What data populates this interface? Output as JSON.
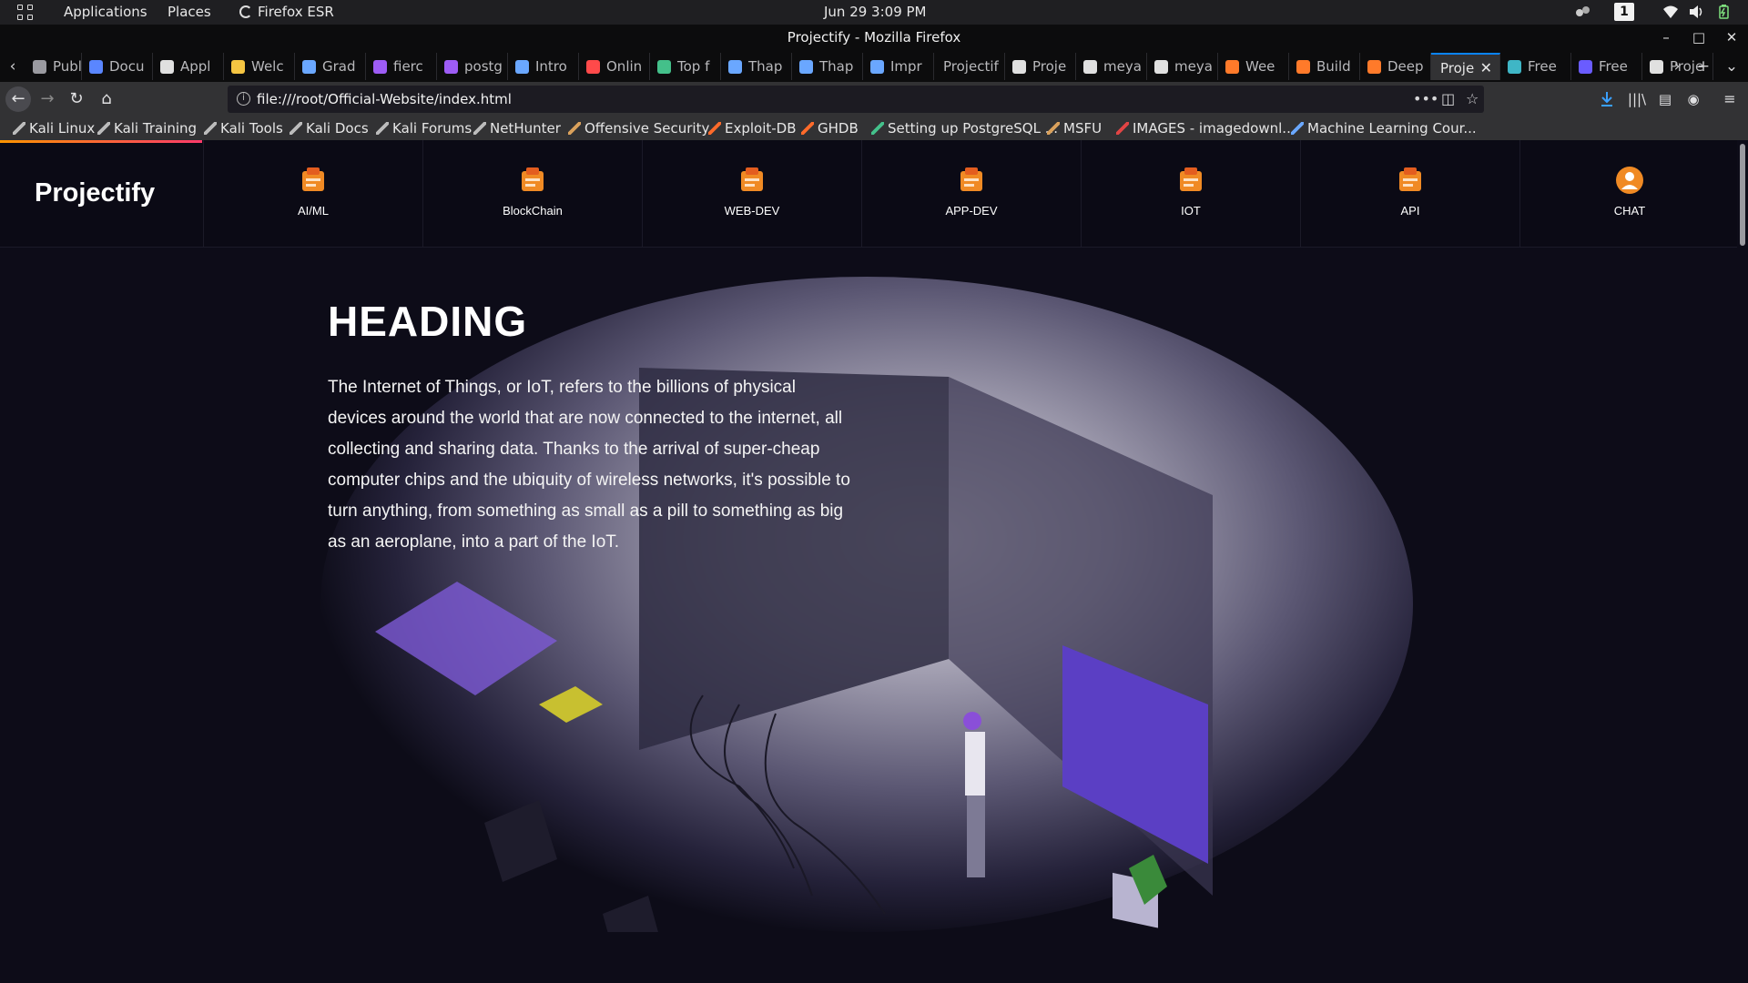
{
  "os_bar": {
    "applications": "Applications",
    "places": "Places",
    "browser": "Firefox ESR",
    "datetime": "Jun 29  3:09 PM",
    "workspace": "1"
  },
  "window": {
    "title": "Projectify - Mozilla Firefox"
  },
  "tabs": [
    {
      "label": "Publi",
      "color": "#9a9aa0"
    },
    {
      "label": "Docu",
      "color": "#5a86ff"
    },
    {
      "label": "Appl",
      "color": "#e0e0e0"
    },
    {
      "label": "Welc",
      "color": "#f5c542"
    },
    {
      "label": "Grad",
      "color": "#6aa7ff"
    },
    {
      "label": "fierc",
      "color": "#9d5cf5"
    },
    {
      "label": "postg",
      "color": "#9d5cf5"
    },
    {
      "label": "Intro",
      "color": "#6aa7ff"
    },
    {
      "label": "Onlin",
      "color": "#ff4a4a"
    },
    {
      "label": "Top f",
      "color": "#44c08a"
    },
    {
      "label": "Thap",
      "color": "#6aa7ff"
    },
    {
      "label": "Thap",
      "color": "#6aa7ff"
    },
    {
      "label": "Impr",
      "color": "#6aa7ff"
    },
    {
      "label": "Projectif",
      "color": ""
    },
    {
      "label": "Proje",
      "color": "#e0e0e0"
    },
    {
      "label": "meya",
      "color": "#e0e0e0"
    },
    {
      "label": "meya",
      "color": "#e0e0e0"
    },
    {
      "label": "Wee",
      "color": "#ff7a2a"
    },
    {
      "label": "Build",
      "color": "#ff7a2a"
    },
    {
      "label": "Deep",
      "color": "#ff7a2a"
    },
    {
      "label": "Proje",
      "color": "",
      "active": true
    },
    {
      "label": "Free",
      "color": "#3fb6c6"
    },
    {
      "label": "Free",
      "color": "#6a5cff"
    },
    {
      "label": "Proje",
      "color": "#e0e0e0"
    }
  ],
  "urlbar": {
    "url": "file:///root/Official-Website/index.html"
  },
  "bookmarks": [
    {
      "label": "Kali Linux",
      "color": "#bbbbbb"
    },
    {
      "label": "Kali Training",
      "color": "#bbbbbb"
    },
    {
      "label": "Kali Tools",
      "color": "#bbbbbb"
    },
    {
      "label": "Kali Docs",
      "color": "#bbbbbb"
    },
    {
      "label": "Kali Forums",
      "color": "#bbbbbb"
    },
    {
      "label": "NetHunter",
      "color": "#bbbbbb"
    },
    {
      "label": "Offensive Security",
      "color": "#d9a05b"
    },
    {
      "label": "Exploit-DB",
      "color": "#ff6a2a"
    },
    {
      "label": "GHDB",
      "color": "#ff6a2a"
    },
    {
      "label": "Setting up PostgreSQL ...",
      "color": "#44c08a"
    },
    {
      "label": "MSFU",
      "color": "#d9a05b"
    },
    {
      "label": "IMAGES - imagedownl...",
      "color": "#e04444"
    },
    {
      "label": "Machine Learning Cour...",
      "color": "#6aa7ff"
    }
  ],
  "site": {
    "brand": "Projectify",
    "nav": [
      {
        "label": "AI/ML",
        "icon": "ai-ml-icon"
      },
      {
        "label": "BlockChain",
        "icon": "blockchain-icon"
      },
      {
        "label": "WEB-DEV",
        "icon": "web-dev-icon"
      },
      {
        "label": "APP-DEV",
        "icon": "app-dev-icon"
      },
      {
        "label": "IOT",
        "icon": "iot-icon"
      },
      {
        "label": "API",
        "icon": "api-icon"
      },
      {
        "label": "CHAT",
        "icon": "chat-icon"
      }
    ],
    "heading": "HEADING",
    "paragraph": "The Internet of Things, or IoT, refers to the billions of physical devices around the world that are now connected to the internet, all collecting and sharing data. Thanks to the arrival of super-cheap computer chips and the ubiquity of wireless networks, it's possible to turn anything, from something as small as a pill to something as big as an aeroplane, into a part of the IoT.",
    "accent": "#f08a24"
  }
}
